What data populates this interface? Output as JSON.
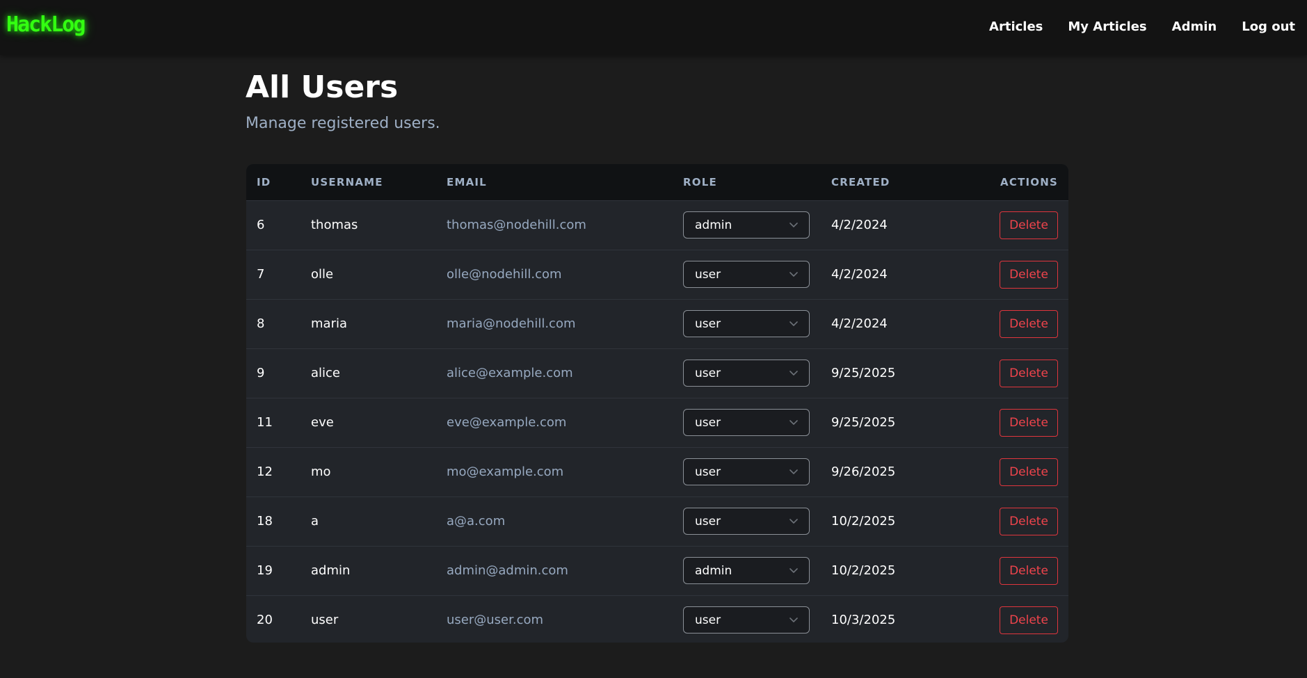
{
  "app": {
    "logo": "HackLog"
  },
  "nav": {
    "articles": "Articles",
    "my_articles": "My Articles",
    "admin": "Admin",
    "logout": "Log out"
  },
  "page": {
    "title": "All Users",
    "subtitle": "Manage registered users."
  },
  "table": {
    "headers": {
      "id": "ID",
      "username": "USERNAME",
      "email": "EMAIL",
      "role": "ROLE",
      "created": "CREATED",
      "actions": "ACTIONS"
    },
    "delete_label": "Delete",
    "rows": [
      {
        "id": "6",
        "username": "thomas",
        "email": "thomas@nodehill.com",
        "role": "admin",
        "created": "4/2/2024"
      },
      {
        "id": "7",
        "username": "olle",
        "email": "olle@nodehill.com",
        "role": "user",
        "created": "4/2/2024"
      },
      {
        "id": "8",
        "username": "maria",
        "email": "maria@nodehill.com",
        "role": "user",
        "created": "4/2/2024"
      },
      {
        "id": "9",
        "username": "alice",
        "email": "alice@example.com",
        "role": "user",
        "created": "9/25/2025"
      },
      {
        "id": "11",
        "username": "eve",
        "email": "eve@example.com",
        "role": "user",
        "created": "9/25/2025"
      },
      {
        "id": "12",
        "username": "mo",
        "email": "mo@example.com",
        "role": "user",
        "created": "9/26/2025"
      },
      {
        "id": "18",
        "username": "a",
        "email": "a@a.com",
        "role": "user",
        "created": "10/2/2025"
      },
      {
        "id": "19",
        "username": "admin",
        "email": "admin@admin.com",
        "role": "admin",
        "created": "10/2/2025"
      },
      {
        "id": "20",
        "username": "user",
        "email": "user@user.com",
        "role": "user",
        "created": "10/3/2025"
      }
    ]
  },
  "colors": {
    "logo": "#33ff11",
    "delete": "#e0353d",
    "email": "#97a9c0",
    "background": "#1c1c1c"
  },
  "icons": {
    "role_dropdown": "chevron-down-icon"
  }
}
